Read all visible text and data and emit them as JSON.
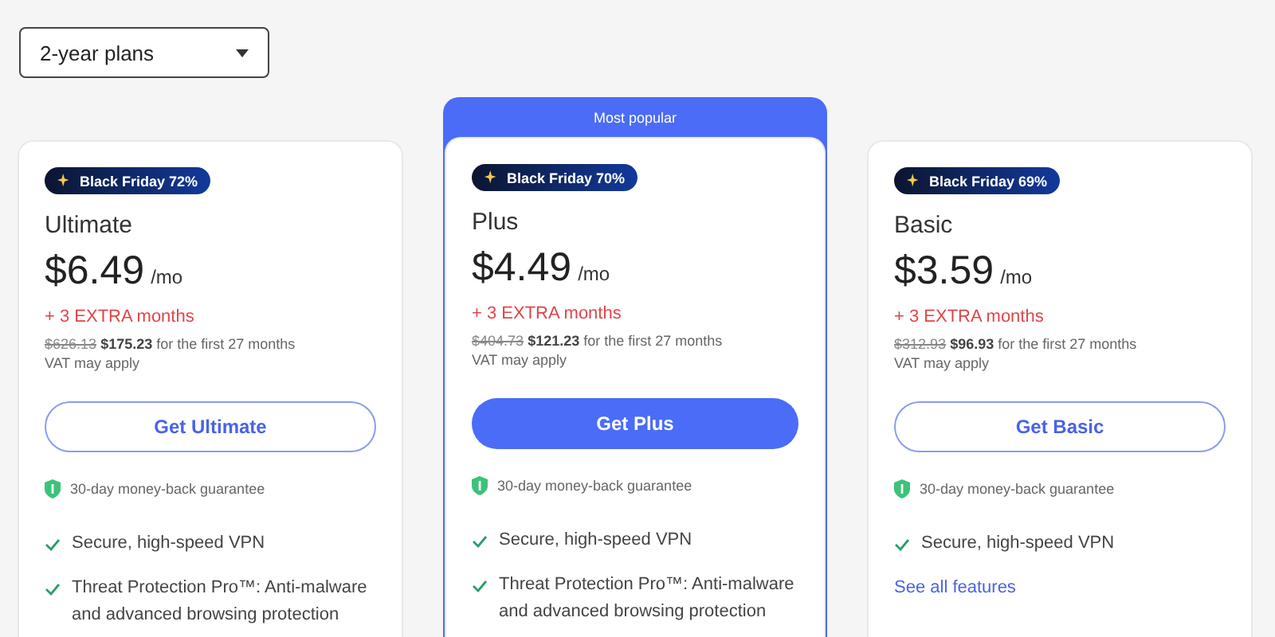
{
  "plan_select": {
    "value": "2-year plans"
  },
  "plans": [
    {
      "badge": "Black Friday 72%",
      "name": "Ultimate",
      "price": "$6.49",
      "unit": "/mo",
      "extra": "+ 3 EXTRA months",
      "old_price": "$626.13",
      "new_price": "$175.23",
      "term": "for the first 27 months",
      "vat": "VAT may apply",
      "button": {
        "label": "Get Ultimate",
        "kind": "outline"
      },
      "guarantee": "30-day money-back guarantee",
      "features": [
        "Secure, high-speed VPN",
        "Threat Protection Pro™: Anti-malware and advanced browsing protection"
      ]
    },
    {
      "banner": "Most popular",
      "badge": "Black Friday 70%",
      "name": "Plus",
      "price": "$4.49",
      "unit": "/mo",
      "extra": "+ 3 EXTRA months",
      "old_price": "$404.73",
      "new_price": "$121.23",
      "term": "for the first 27 months",
      "vat": "VAT may apply",
      "button": {
        "label": "Get Plus",
        "kind": "filled"
      },
      "guarantee": "30-day money-back guarantee",
      "features": [
        "Secure, high-speed VPN",
        "Threat Protection Pro™: Anti-malware and advanced browsing protection"
      ]
    },
    {
      "badge": "Black Friday 69%",
      "name": "Basic",
      "price": "$3.59",
      "unit": "/mo",
      "extra": "+ 3 EXTRA months",
      "old_price": "$312.93",
      "new_price": "$96.93",
      "term": "for the first 27 months",
      "vat": "VAT may apply",
      "button": {
        "label": "Get Basic",
        "kind": "outline"
      },
      "guarantee": "30-day money-back guarantee",
      "features": [
        "Secure, high-speed VPN"
      ],
      "link": "See all features"
    }
  ]
}
